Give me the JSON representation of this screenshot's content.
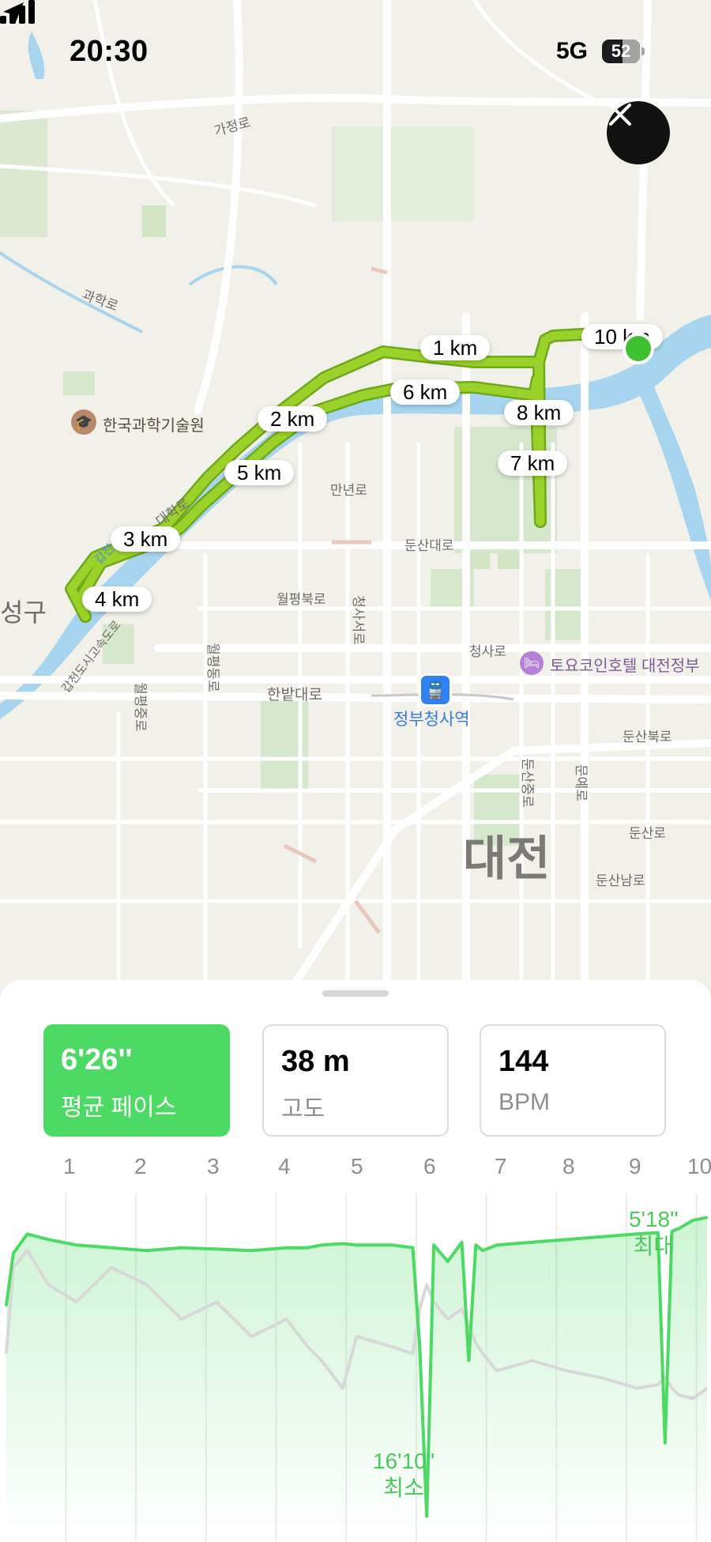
{
  "status_bar": {
    "time": "20:30",
    "network": "5G",
    "battery": "52"
  },
  "map": {
    "labels": {
      "gajeong_ro": "가정로",
      "gwahak_ro": "과학로",
      "science_museum": "한국과학기술원",
      "daehak_ro": "대학로",
      "seong_gu": "성구",
      "gapcheon_road": "갑천도시고속도로",
      "gapcheon": "갑천",
      "manyeon_ro": "만년로",
      "dunsan_daero": "둔산대로",
      "wolpyeong_buk_ro": "월평북로",
      "cheongsa_seo_ro": "청사서로",
      "wolpyeong_dong_ro": "월평동로",
      "wolpyeong_jung_ro": "월평중로",
      "hanbat_daero": "한밭대로",
      "cheongsa_ro": "청사로",
      "hotel": "토요코인호텔 대전정부",
      "station": "정부청사역",
      "dunsan_buk_ro": "둔산북로",
      "dunsan_jung_ro": "둔산중로",
      "munye_ro": "문예로",
      "dunsan_ro": "둔산로",
      "dunsan_nam_ro": "둔산남로",
      "city": "대전"
    },
    "km_markers": [
      "1 km",
      "2 km",
      "3 km",
      "4 km",
      "5 km",
      "6 km",
      "7 km",
      "8 km",
      "10 km"
    ],
    "colors": {
      "route": "#9bd22a",
      "route_outline": "#6fa81d",
      "water": "#a7d5ef",
      "park": "#d9ead0",
      "current_position": "#3ec12f"
    }
  },
  "metrics": [
    {
      "value": "6'26''",
      "label": "평균 페이스",
      "active": true
    },
    {
      "value": "38 m",
      "label": "고도",
      "active": false
    },
    {
      "value": "144",
      "label": "BPM",
      "active": false
    }
  ],
  "km_axis": [
    "1",
    "2",
    "3",
    "4",
    "5",
    "6",
    "7",
    "8",
    "9",
    "10"
  ],
  "chart_data": {
    "type": "line",
    "title": "",
    "xlabel": "",
    "ylabel": "",
    "x_unit": "km",
    "x": [
      0.0,
      0.1,
      0.3,
      0.6,
      1.0,
      1.5,
      2.0,
      2.5,
      3.0,
      3.5,
      4.0,
      4.3,
      4.5,
      4.8,
      5.0,
      5.5,
      5.8,
      5.9,
      6.0,
      6.1,
      6.3,
      6.5,
      6.6,
      6.7,
      6.8,
      7.0,
      7.5,
      8.0,
      8.5,
      9.0,
      9.3,
      9.4,
      9.5,
      9.6,
      9.8,
      10.0
    ],
    "series": [
      {
        "name": "평균 페이스",
        "values": [
          8.5,
          6.6,
          5.9,
          6.1,
          6.3,
          6.4,
          6.5,
          6.4,
          6.45,
          6.5,
          6.4,
          6.4,
          6.3,
          6.25,
          6.3,
          6.3,
          6.4,
          10.0,
          16.17,
          6.3,
          6.9,
          6.2,
          10.5,
          6.3,
          6.5,
          6.3,
          6.2,
          6.1,
          6.0,
          5.9,
          5.85,
          13.5,
          5.8,
          5.7,
          5.4,
          5.3
        ]
      },
      {
        "name": "고도",
        "values": [
          7.0,
          9.5,
          10.0,
          9.0,
          8.5,
          9.5,
          9.0,
          8.0,
          8.5,
          7.5,
          8.0,
          7.2,
          6.8,
          6.0,
          7.5,
          7.2,
          7.0,
          8.3,
          9.0,
          8.5,
          8.0,
          8.3,
          7.8,
          7.3,
          7.0,
          6.5,
          6.8,
          6.5,
          6.3,
          6.0,
          6.1,
          6.3,
          6.0,
          5.8,
          5.7,
          6.0
        ]
      }
    ],
    "y_reversed": true,
    "annotations": [
      {
        "label": "최대",
        "value": "5'18''"
      },
      {
        "label": "최소",
        "value": "16'10''"
      }
    ],
    "colors": {
      "pace": "#4cd964",
      "elevation": "#d8d8d8"
    }
  }
}
